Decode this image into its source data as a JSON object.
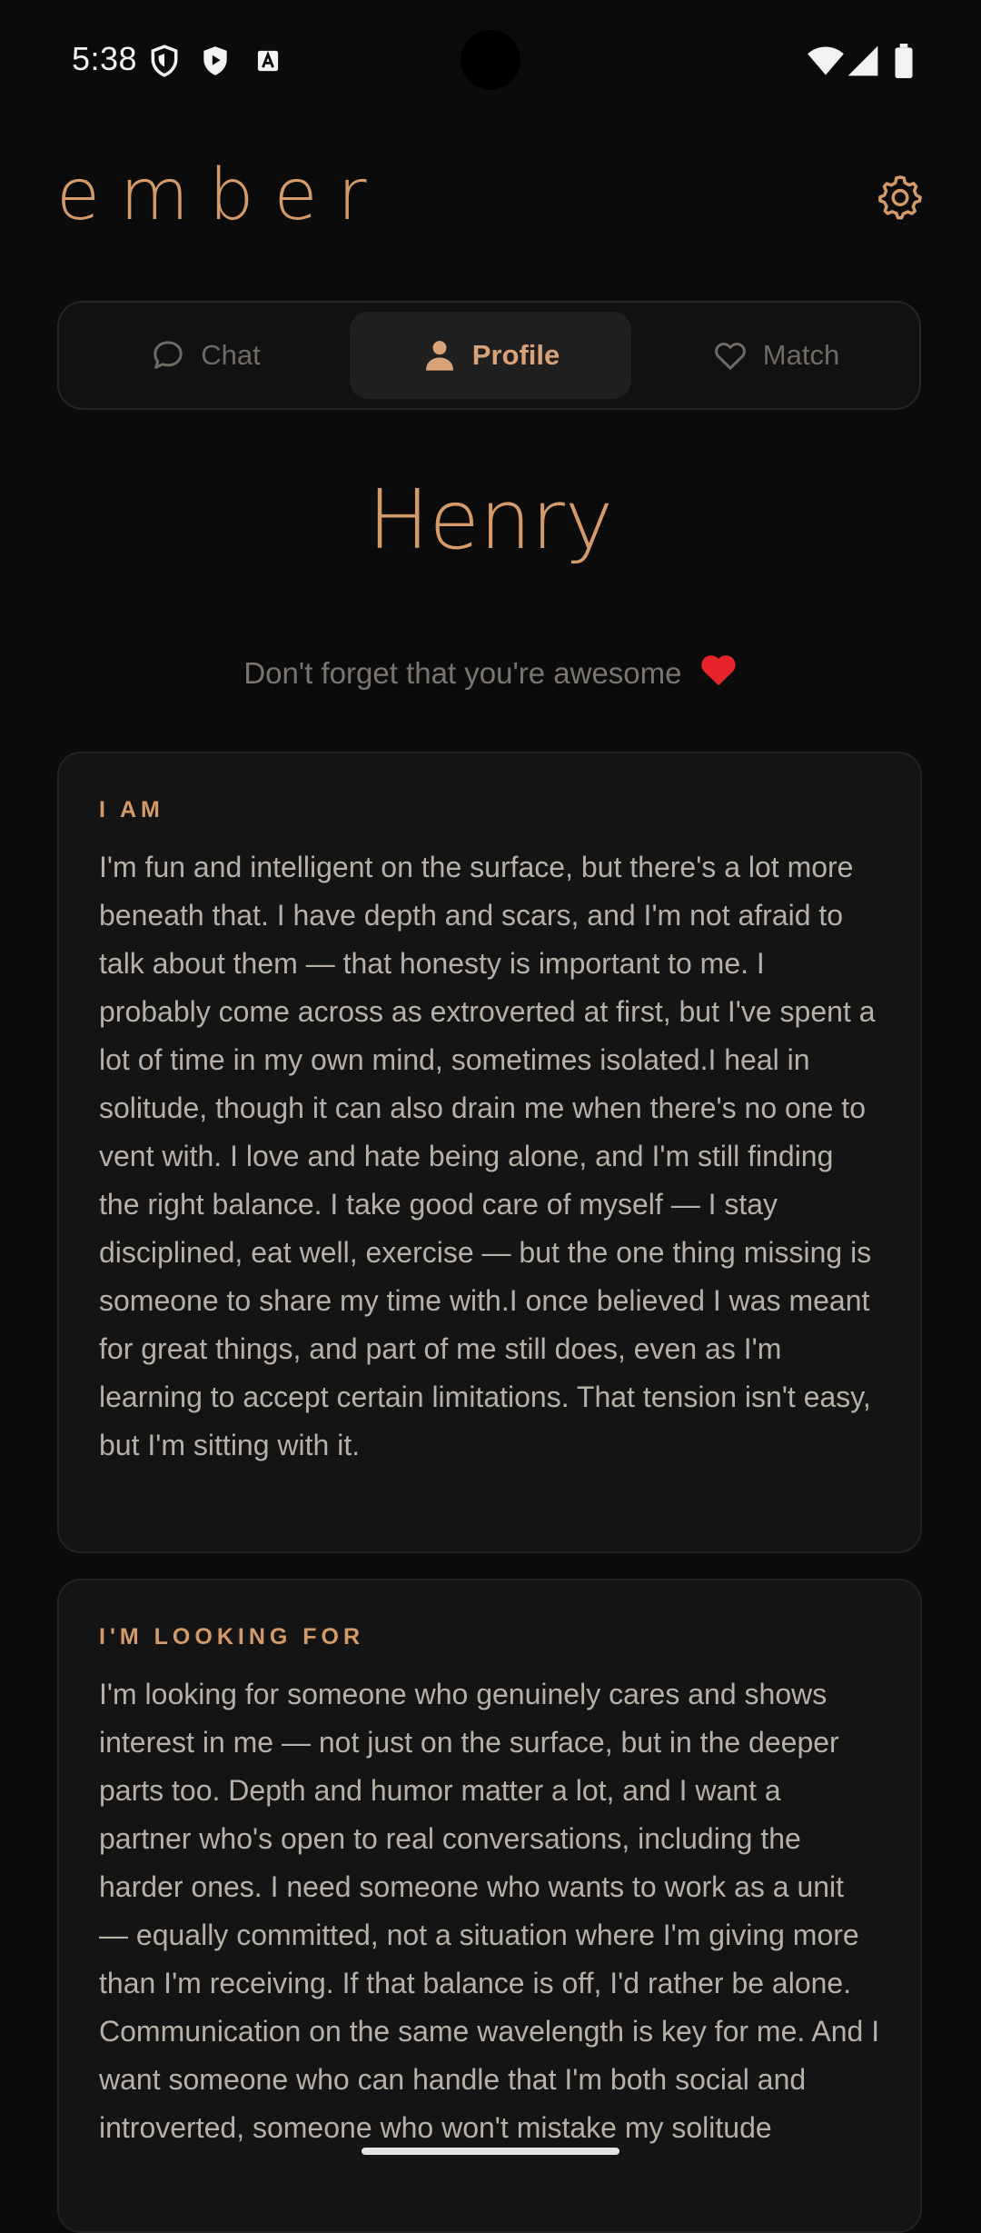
{
  "status_bar": {
    "time": "5:38",
    "left_icons": [
      "shield-outline-icon",
      "play-shield-icon",
      "font-a-icon"
    ],
    "right_icons": [
      "wifi-icon",
      "signal-icon",
      "battery-icon"
    ]
  },
  "header": {
    "app_name": "ember",
    "settings_icon": "gear-icon"
  },
  "tabs": [
    {
      "label": "Chat",
      "icon": "chat-bubble-icon",
      "active": false
    },
    {
      "label": "Profile",
      "icon": "person-icon",
      "active": true
    },
    {
      "label": "Match",
      "icon": "heart-outline-icon",
      "active": false
    }
  ],
  "profile": {
    "name": "Henry",
    "tagline": "Don't forget that you're awesome",
    "tagline_emoji": "red-heart-icon"
  },
  "sections": [
    {
      "label": "I AM",
      "body": "I'm fun and intelligent on the surface, but there's a lot more beneath that. I have depth and scars, and I'm not afraid to talk about them — that honesty is important to me. I probably come across as extroverted at first, but I've spent a lot of time in my own mind, sometimes isolated.I heal in solitude, though it can also drain me when there's no one to vent with. I love and hate being alone, and I'm still finding the right balance. I take good care of myself — I stay disciplined, eat well, exercise — but the one thing missing is someone to share my time with.I once believed I was meant for great things, and part of me still does, even as I'm learning to accept certain limitations. That tension isn't easy, but I'm sitting with it."
    },
    {
      "label": "I'M LOOKING FOR",
      "body": "I'm looking for someone who genuinely cares and shows interest in me — not just on the surface, but in the deeper parts too. Depth and humor matter a lot, and I want a partner who's open to real conversations, including the harder ones. I need someone who wants to work as a unit — equally committed, not a situation where I'm giving more than I'm receiving. If that balance is off, I'd rather be alone. Communication on the same wavelength is key for me. And I want someone who can handle that I'm both social and introverted, someone who won't mistake my solitude"
    }
  ],
  "colors": {
    "background": "#0b0b0b",
    "accent": "#d49a6a",
    "card": "#141414",
    "text": "#b7b0a8",
    "muted": "#6f6a65",
    "heart": "#e5242b"
  }
}
